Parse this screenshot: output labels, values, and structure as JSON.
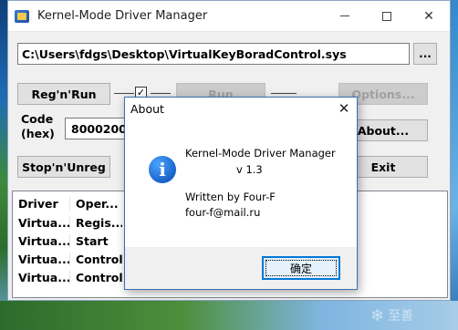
{
  "window": {
    "title": "Kernel-Mode Driver Manager",
    "icon": "driver-manager-app-icon",
    "controls": {
      "minimize": "minimize-icon",
      "maximize": "maximize-icon",
      "close": "✕"
    }
  },
  "path": {
    "value": "C:\\Users\\fdgs\\Desktop\\VirtualKeyBoradControl.sys",
    "browse_label": "..."
  },
  "buttons": {
    "reg_n_run": "Reg'n'Run",
    "run": "Run",
    "options": "Options...",
    "about": "About...",
    "stop_n_unreg": "Stop'n'Unreg",
    "exit": "Exit"
  },
  "checkbox_mark": "✓",
  "code": {
    "label_line1": "Code",
    "label_line2": "(hex)",
    "value": "80002000"
  },
  "table": {
    "headers": [
      "Driver",
      "Oper..."
    ],
    "rows": [
      [
        "Virtua...",
        "Regis..."
      ],
      [
        "Virtua...",
        "Start"
      ],
      [
        "Virtua...",
        "Control"
      ],
      [
        "Virtua...",
        "Control"
      ]
    ]
  },
  "about_dialog": {
    "title": "About",
    "close": "✕",
    "icon": "information-icon",
    "icon_glyph": "i",
    "line1": "Kernel-Mode Driver Manager",
    "line2": "v 1.3",
    "line3": "Written by Four-F",
    "line4": "four-f@mail.ru",
    "ok_label": "确定"
  },
  "watermark": {
    "glyph": "❄",
    "text": "至善"
  }
}
